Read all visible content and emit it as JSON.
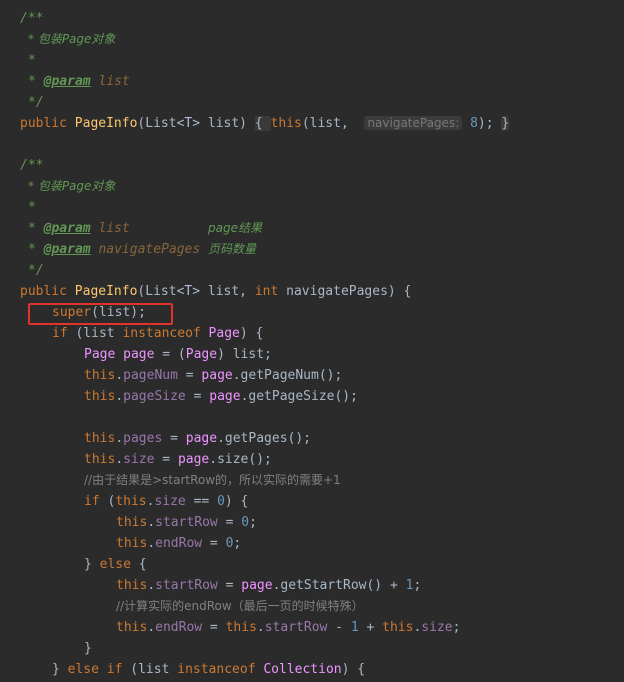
{
  "code_lines": [
    {
      "indent": 20,
      "tokens": [
        {
          "t": "/**",
          "c": "doc"
        }
      ]
    },
    {
      "indent": 28,
      "tokens": [
        {
          "t": "* 包装Page对象",
          "c": "doc"
        }
      ]
    },
    {
      "indent": 28,
      "tokens": [
        {
          "t": "*",
          "c": "doc"
        }
      ]
    },
    {
      "indent": 28,
      "tokens": [
        {
          "t": "* ",
          "c": "doc"
        },
        {
          "t": "@param",
          "c": "doctag"
        },
        {
          "t": " list",
          "c": "docparam"
        }
      ]
    },
    {
      "indent": 28,
      "tokens": [
        {
          "t": "*/",
          "c": "doc"
        }
      ]
    },
    {
      "indent": 20,
      "tokens": [
        {
          "t": "public ",
          "c": "kw"
        },
        {
          "t": "PageInfo",
          "c": "fn"
        },
        {
          "t": "(List",
          "c": "plain"
        },
        {
          "t": "<",
          "c": "plain"
        },
        {
          "t": "T",
          "c": "typeparam"
        },
        {
          "t": "> list) ",
          "c": "plain"
        },
        {
          "t": "{ ",
          "c": "fold"
        },
        {
          "t": "this",
          "c": "kw"
        },
        {
          "t": "(list,  ",
          "c": "plain"
        },
        {
          "t": "navigatePages:",
          "c": "hint"
        },
        {
          "t": " 8",
          "c": "num"
        },
        {
          "t": "); ",
          "c": "plain"
        },
        {
          "t": "}",
          "c": "fold"
        }
      ]
    },
    {
      "indent": 20,
      "tokens": []
    },
    {
      "indent": 20,
      "tokens": [
        {
          "t": "/**",
          "c": "doc"
        }
      ]
    },
    {
      "indent": 28,
      "tokens": [
        {
          "t": "* 包装Page对象",
          "c": "doc"
        }
      ]
    },
    {
      "indent": 28,
      "tokens": [
        {
          "t": "*",
          "c": "doc"
        }
      ]
    },
    {
      "indent": 28,
      "tokens": [
        {
          "t": "* ",
          "c": "doc"
        },
        {
          "t": "@param",
          "c": "doctag"
        },
        {
          "t": " list          ",
          "c": "docparam"
        },
        {
          "t": "page结果",
          "c": "doc"
        }
      ]
    },
    {
      "indent": 28,
      "tokens": [
        {
          "t": "* ",
          "c": "doc"
        },
        {
          "t": "@param",
          "c": "doctag"
        },
        {
          "t": " navigatePages ",
          "c": "docparam"
        },
        {
          "t": "页码数量",
          "c": "doc"
        }
      ]
    },
    {
      "indent": 28,
      "tokens": [
        {
          "t": "*/",
          "c": "doc"
        }
      ]
    },
    {
      "indent": 20,
      "tokens": [
        {
          "t": "public ",
          "c": "kw"
        },
        {
          "t": "PageInfo",
          "c": "fn"
        },
        {
          "t": "(List",
          "c": "plain"
        },
        {
          "t": "<",
          "c": "plain"
        },
        {
          "t": "T",
          "c": "typeparam"
        },
        {
          "t": "> list, ",
          "c": "plain"
        },
        {
          "t": "int ",
          "c": "kw"
        },
        {
          "t": "navigatePages) {",
          "c": "plain"
        }
      ]
    },
    {
      "indent": 52,
      "tokens": [
        {
          "t": "super",
          "c": "kw"
        },
        {
          "t": "(list);",
          "c": "plain"
        }
      ]
    },
    {
      "indent": 52,
      "tokens": [
        {
          "t": "if ",
          "c": "kw"
        },
        {
          "t": "(list ",
          "c": "plain"
        },
        {
          "t": "instanceof ",
          "c": "kw"
        },
        {
          "t": "Page",
          "c": "type"
        },
        {
          "t": ") {",
          "c": "plain"
        }
      ]
    },
    {
      "indent": 84,
      "tokens": [
        {
          "t": "Page ",
          "c": "type"
        },
        {
          "t": "page",
          "c": "type"
        },
        {
          "t": " = (",
          "c": "plain"
        },
        {
          "t": "Page",
          "c": "type"
        },
        {
          "t": ") list;",
          "c": "plain"
        }
      ]
    },
    {
      "indent": 84,
      "tokens": [
        {
          "t": "this",
          "c": "kw"
        },
        {
          "t": ".",
          "c": "plain"
        },
        {
          "t": "pageNum",
          "c": "field"
        },
        {
          "t": " = ",
          "c": "plain"
        },
        {
          "t": "page",
          "c": "type"
        },
        {
          "t": ".getPageNum();",
          "c": "plain"
        }
      ]
    },
    {
      "indent": 84,
      "tokens": [
        {
          "t": "this",
          "c": "kw"
        },
        {
          "t": ".",
          "c": "plain"
        },
        {
          "t": "pageSize",
          "c": "field"
        },
        {
          "t": " = ",
          "c": "plain"
        },
        {
          "t": "page",
          "c": "type"
        },
        {
          "t": ".getPageSize();",
          "c": "plain"
        }
      ]
    },
    {
      "indent": 84,
      "tokens": []
    },
    {
      "indent": 84,
      "tokens": [
        {
          "t": "this",
          "c": "kw"
        },
        {
          "t": ".",
          "c": "plain"
        },
        {
          "t": "pages",
          "c": "field"
        },
        {
          "t": " = ",
          "c": "plain"
        },
        {
          "t": "page",
          "c": "type"
        },
        {
          "t": ".getPages();",
          "c": "plain"
        }
      ]
    },
    {
      "indent": 84,
      "tokens": [
        {
          "t": "this",
          "c": "kw"
        },
        {
          "t": ".",
          "c": "plain"
        },
        {
          "t": "size",
          "c": "field"
        },
        {
          "t": " = ",
          "c": "plain"
        },
        {
          "t": "page",
          "c": "type"
        },
        {
          "t": ".size();",
          "c": "plain"
        }
      ]
    },
    {
      "indent": 84,
      "tokens": [
        {
          "t": "//由于结果是>startRow的，所以实际的需要+1",
          "c": "comment"
        }
      ]
    },
    {
      "indent": 84,
      "tokens": [
        {
          "t": "if ",
          "c": "kw"
        },
        {
          "t": "(",
          "c": "plain"
        },
        {
          "t": "this",
          "c": "kw"
        },
        {
          "t": ".",
          "c": "plain"
        },
        {
          "t": "size",
          "c": "field"
        },
        {
          "t": " == ",
          "c": "plain"
        },
        {
          "t": "0",
          "c": "num"
        },
        {
          "t": ") {",
          "c": "plain"
        }
      ]
    },
    {
      "indent": 116,
      "tokens": [
        {
          "t": "this",
          "c": "kw"
        },
        {
          "t": ".",
          "c": "plain"
        },
        {
          "t": "startRow",
          "c": "field"
        },
        {
          "t": " = ",
          "c": "plain"
        },
        {
          "t": "0",
          "c": "num"
        },
        {
          "t": ";",
          "c": "plain"
        }
      ]
    },
    {
      "indent": 116,
      "tokens": [
        {
          "t": "this",
          "c": "kw"
        },
        {
          "t": ".",
          "c": "plain"
        },
        {
          "t": "endRow",
          "c": "field"
        },
        {
          "t": " = ",
          "c": "plain"
        },
        {
          "t": "0",
          "c": "num"
        },
        {
          "t": ";",
          "c": "plain"
        }
      ]
    },
    {
      "indent": 84,
      "tokens": [
        {
          "t": "} ",
          "c": "plain"
        },
        {
          "t": "else ",
          "c": "kw"
        },
        {
          "t": "{",
          "c": "plain"
        }
      ]
    },
    {
      "indent": 116,
      "tokens": [
        {
          "t": "this",
          "c": "kw"
        },
        {
          "t": ".",
          "c": "plain"
        },
        {
          "t": "startRow",
          "c": "field"
        },
        {
          "t": " = ",
          "c": "plain"
        },
        {
          "t": "page",
          "c": "type"
        },
        {
          "t": ".getStartRow() + ",
          "c": "plain"
        },
        {
          "t": "1",
          "c": "num"
        },
        {
          "t": ";",
          "c": "plain"
        }
      ]
    },
    {
      "indent": 116,
      "tokens": [
        {
          "t": "//计算实际的endRow（最后一页的时候特殊）",
          "c": "comment"
        }
      ]
    },
    {
      "indent": 116,
      "tokens": [
        {
          "t": "this",
          "c": "kw"
        },
        {
          "t": ".",
          "c": "plain"
        },
        {
          "t": "endRow",
          "c": "field"
        },
        {
          "t": " = ",
          "c": "plain"
        },
        {
          "t": "this",
          "c": "kw"
        },
        {
          "t": ".",
          "c": "plain"
        },
        {
          "t": "startRow",
          "c": "field"
        },
        {
          "t": " - ",
          "c": "plain"
        },
        {
          "t": "1",
          "c": "num"
        },
        {
          "t": " + ",
          "c": "plain"
        },
        {
          "t": "this",
          "c": "kw"
        },
        {
          "t": ".",
          "c": "plain"
        },
        {
          "t": "size",
          "c": "field"
        },
        {
          "t": ";",
          "c": "plain"
        }
      ]
    },
    {
      "indent": 84,
      "tokens": [
        {
          "t": "}",
          "c": "plain"
        }
      ]
    },
    {
      "indent": 52,
      "tokens": [
        {
          "t": "} ",
          "c": "plain"
        },
        {
          "t": "else if ",
          "c": "kw"
        },
        {
          "t": "(list ",
          "c": "plain"
        },
        {
          "t": "instanceof ",
          "c": "kw"
        },
        {
          "t": "Collection",
          "c": "type"
        },
        {
          "t": ") {",
          "c": "plain"
        }
      ]
    }
  ],
  "highlight": {
    "line_index": 14,
    "color": "#e0332b"
  },
  "colors": {
    "background": "#2b2b2b",
    "keyword": "#cc7832",
    "method": "#ffc66d",
    "type": "#ed94ff",
    "doc": "#629755",
    "field": "#9876aa",
    "number": "#6897bb",
    "comment": "#808080",
    "text": "#a9b7c6"
  }
}
